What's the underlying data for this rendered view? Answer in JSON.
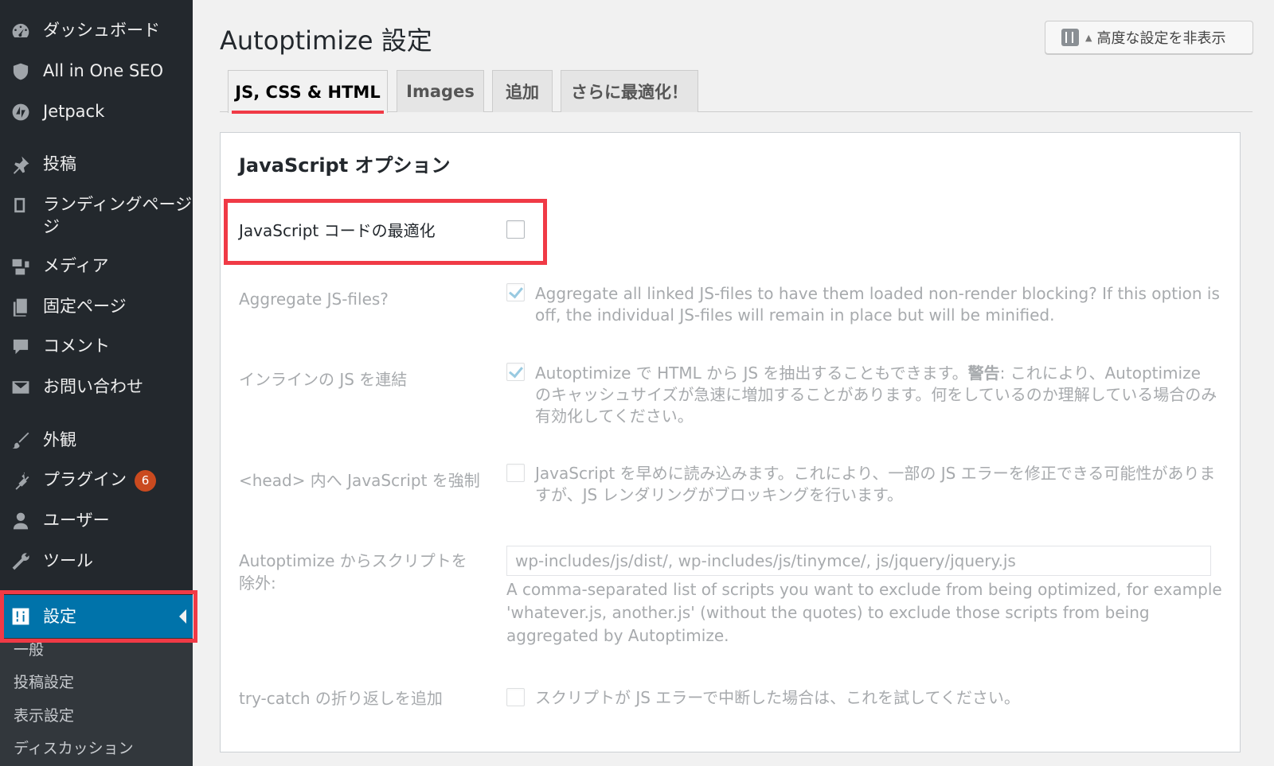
{
  "sidebar": {
    "items": [
      {
        "label": "ダッシュボード",
        "icon": "dashboard-icon"
      },
      {
        "label": "All in One SEO",
        "icon": "shield-icon"
      },
      {
        "label": "Jetpack",
        "icon": "jetpack-icon"
      },
      {
        "label": "投稿",
        "icon": "pin-icon"
      },
      {
        "label": "ランディングページ",
        "label_line2": "ジ",
        "icon": "page-icon"
      },
      {
        "label": "メディア",
        "icon": "media-icon"
      },
      {
        "label": "固定ページ",
        "icon": "pages-icon"
      },
      {
        "label": "コメント",
        "icon": "comment-icon"
      },
      {
        "label": "お問い合わせ",
        "icon": "mail-icon"
      },
      {
        "label": "外観",
        "icon": "brush-icon"
      },
      {
        "label": "プラグイン",
        "icon": "plugin-icon",
        "badge": "6"
      },
      {
        "label": "ユーザー",
        "icon": "user-icon"
      },
      {
        "label": "ツール",
        "icon": "wrench-icon"
      },
      {
        "label": "設定",
        "icon": "settings-icon",
        "active": true
      }
    ],
    "submenu": [
      "一般",
      "投稿設定",
      "表示設定",
      "ディスカッション"
    ]
  },
  "header": {
    "title": "Autoptimize 設定",
    "toggle_label": "高度な設定を非表示",
    "toggle_caret": "▲"
  },
  "tabs": [
    {
      "label": "JS, CSS & HTML",
      "active": true
    },
    {
      "label": "Images"
    },
    {
      "label": "追加"
    },
    {
      "label": "さらに最適化！"
    }
  ],
  "section": {
    "title": "JavaScript オプション",
    "optimize_js": {
      "label": "JavaScript コードの最適化",
      "checked": false
    },
    "aggregate": {
      "label": "Aggregate JS-files?",
      "checked": true,
      "description": "Aggregate all linked JS-files to have them loaded non-render blocking? If this option is off, the individual JS-files will remain in place but will be minified."
    },
    "inline": {
      "label": "インラインの JS を連結",
      "checked": true,
      "desc_before": "Autoptimize で HTML から JS を抽出することもできます。",
      "desc_bold": "警告",
      "desc_after": ": これにより、Autoptimize のキャッシュサイズが急速に増加することがあります。何をしているのか理解している場合のみ有効化してください。"
    },
    "force_head": {
      "label": "<head> 内へ JavaScript を強制",
      "checked": false,
      "description": "JavaScript を早めに読み込みます。これにより、一部の JS エラーを修正できる可能性がありますが、JS レンダリングがブロッキングを行います。"
    },
    "exclude": {
      "label": "Autoptimize からスクリプトを除外:",
      "value": "wp-includes/js/dist/, wp-includes/js/tinymce/, js/jquery/jquery.js",
      "help": "A comma-separated list of scripts you want to exclude from being optimized, for example 'whatever.js, another.js' (without the quotes) to exclude those scripts from being aggregated by Autoptimize."
    },
    "try_catch": {
      "label": "try-catch の折り返しを追加",
      "checked": false,
      "description": "スクリプトが JS エラーで中断した場合は、これを試してください。"
    }
  },
  "colors": {
    "sidebar_bg": "#23282d",
    "active_menu": "#0073aa",
    "highlight": "#f03a46",
    "badge": "#ca4a1f"
  }
}
